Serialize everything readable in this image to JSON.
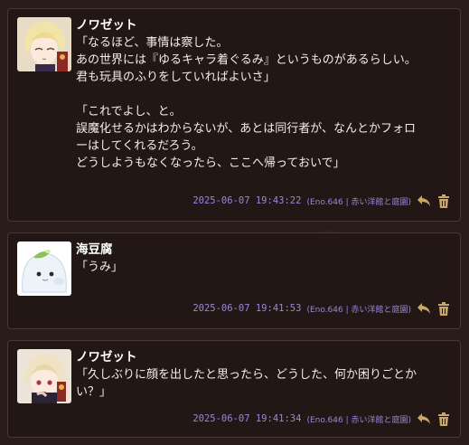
{
  "colors": {
    "background": "#2a1c19",
    "card": "#231715",
    "timestamp": "#9b86d9",
    "icon": "#c9a76a"
  },
  "messages": [
    {
      "name": "ノワゼット",
      "text": "「なるほど、事情は察した。\nあの世界には『ゆるキャラ着ぐるみ』というものがあるらしい。\n君も玩具のふりをしていればよいさ」\n\n「これでよし、と。\n誤魔化せるかはわからないが、あとは同行者が、なんとかフォロ\nーはしてくれるだろう。\nどうしようもなくなったら、ここへ帰っておいで」",
      "timestamp": "2025-06-07 19:43:22",
      "eno": "(Eno.646 | 赤い洋館と庭園)",
      "reply_icon": "reply-icon",
      "delete_icon": "trash-icon"
    },
    {
      "name": "海豆腐",
      "text": "「うみ」",
      "timestamp": "2025-06-07 19:41:53",
      "eno": "(Eno.646 | 赤い洋館と庭園)",
      "reply_icon": "reply-icon",
      "delete_icon": "trash-icon"
    },
    {
      "name": "ノワゼット",
      "text": "「久しぶりに顔を出したと思ったら、どうした、何か困りごとか\nい？」",
      "timestamp": "2025-06-07 19:41:34",
      "eno": "(Eno.646 | 赤い洋館と庭園)",
      "reply_icon": "reply-icon",
      "delete_icon": "trash-icon"
    }
  ]
}
